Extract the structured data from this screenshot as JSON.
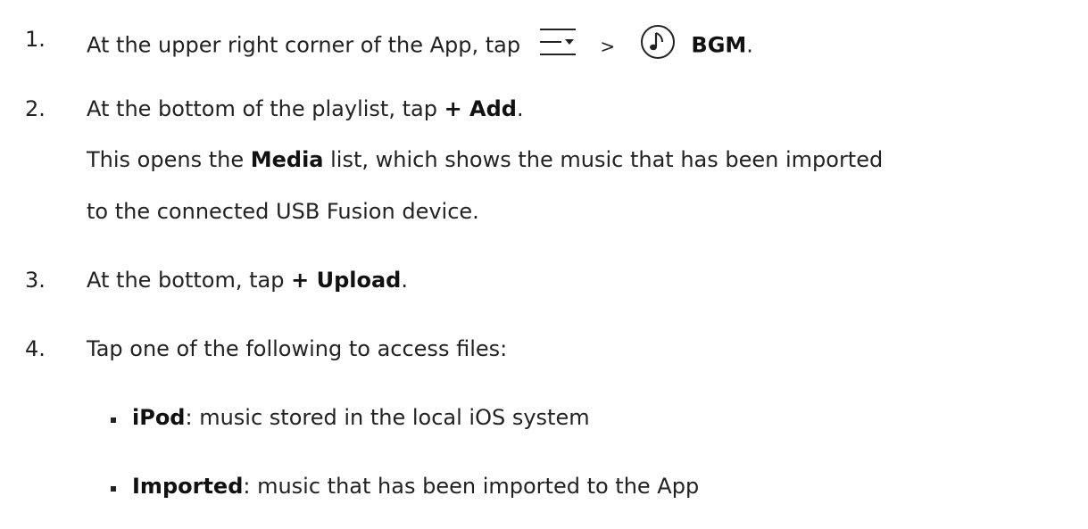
{
  "steps": [
    {
      "number": "1.",
      "prefix": "At the upper right corner of the App, tap",
      "separator": ">",
      "target": "BGM",
      "end": ".",
      "icons": [
        "menu-dropdown-icon",
        "music-note-icon"
      ]
    },
    {
      "number": "2.",
      "prefix": "At the bottom of the playlist, tap",
      "target": "+ Add",
      "end": ".",
      "note_prefix": "This opens the",
      "note_bold": "Media",
      "note_suffix": "list, which shows the music that has been imported",
      "note_line2": "to the connected USB Fusion device."
    },
    {
      "number": "3.",
      "prefix": "At the bottom, tap",
      "target": "+ Upload",
      "end": "."
    },
    {
      "number": "4.",
      "text": "Tap one of the following to access files:"
    }
  ],
  "options": [
    {
      "term": "iPod",
      "desc": ": music stored in the local iOS system"
    },
    {
      "term": "Imported",
      "desc": ": music that has been imported to the App"
    }
  ]
}
